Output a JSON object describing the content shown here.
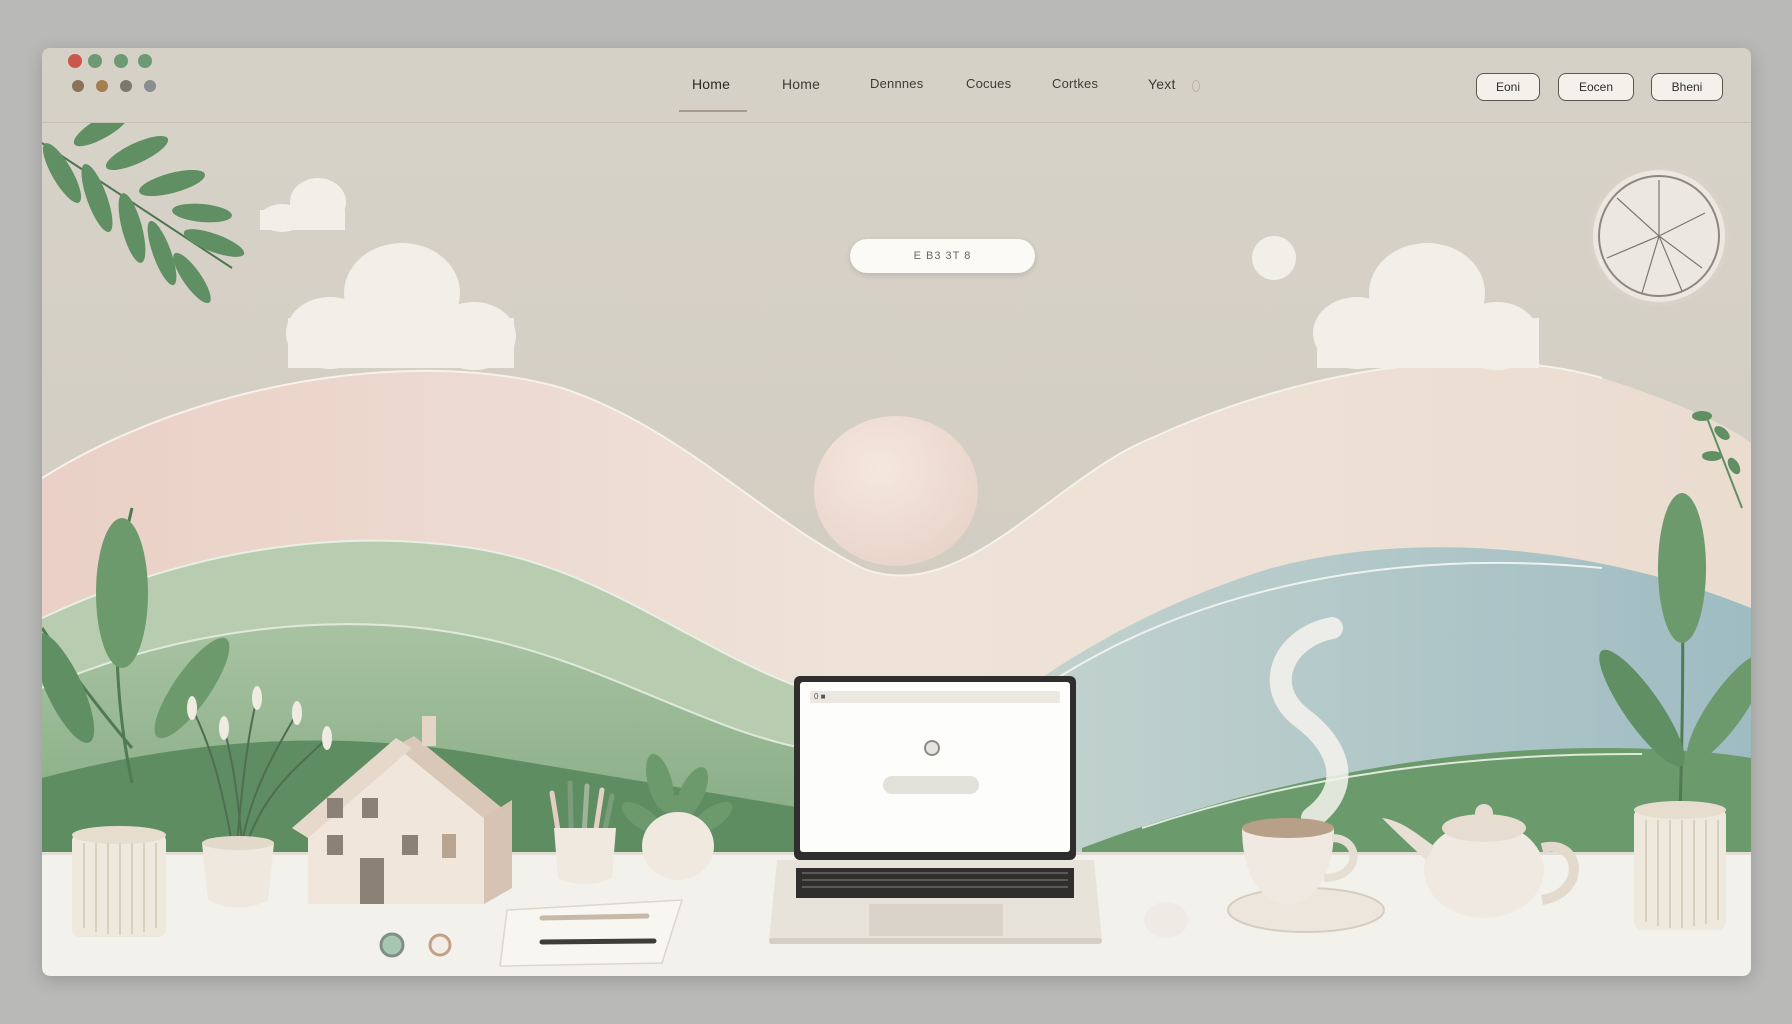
{
  "window_controls": {
    "close_color": "#c9574c",
    "minimize_color": "#6d9a72",
    "maximize_color": "#6d9a72",
    "extra_color": "#6d9a72"
  },
  "nav": {
    "items": [
      {
        "label": "Home",
        "active": true
      },
      {
        "label": "Home"
      },
      {
        "label": "Dennnes"
      },
      {
        "label": "Cocues"
      },
      {
        "label": "Cortkes"
      },
      {
        "label": "Yext"
      }
    ],
    "trailing_icon": "small-circle-icon"
  },
  "toolbar": {
    "buttons": [
      {
        "label": "Eoni"
      },
      {
        "label": "Eocen"
      },
      {
        "label": "Bheni"
      }
    ]
  },
  "hero": {
    "search_text": "E  B3 3T 8",
    "clock_icon": "wall-clock-icon"
  },
  "laptop": {
    "tab_text": "0 ■",
    "icons": [
      "toggle-circle-icon"
    ]
  },
  "colors": {
    "accent_green": "#5f8f63",
    "sand": "#d3cdc2",
    "blush": "#ecd2c9",
    "sage": "#8fb084",
    "mist_blue": "#a9c1c7",
    "desk": "#f3f1ec"
  }
}
